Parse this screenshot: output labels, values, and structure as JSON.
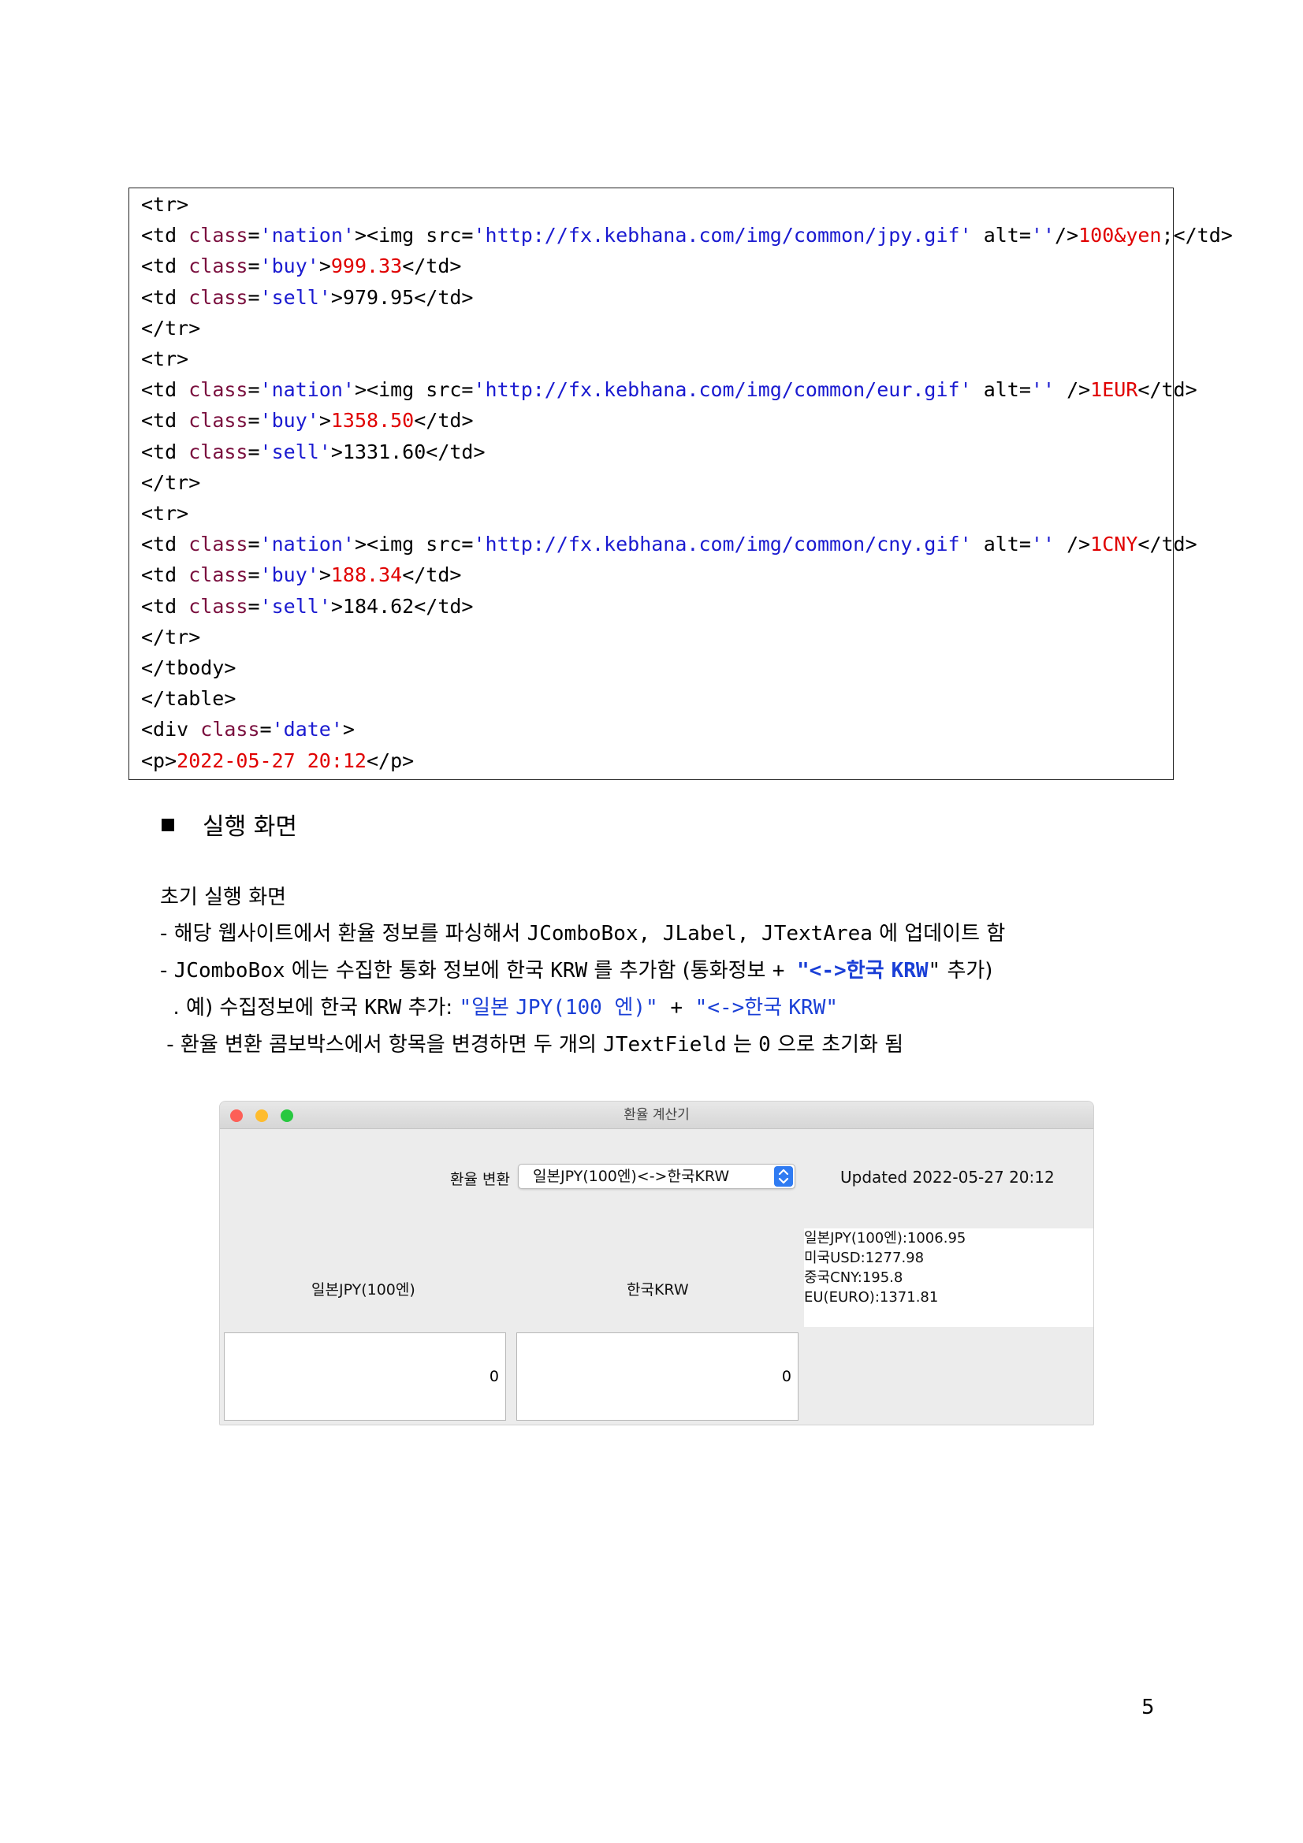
{
  "code": {
    "lines": [
      [
        {
          "t": "t",
          "x": "<tr>"
        }
      ],
      [
        {
          "t": "t",
          "x": "<td "
        },
        {
          "t": "k",
          "x": "class"
        },
        {
          "t": "t",
          "x": "="
        },
        {
          "t": "s",
          "x": "'nation'"
        },
        {
          "t": "t",
          "x": "><img src="
        },
        {
          "t": "s",
          "x": "'http://fx.kebhana.com/img/common/jpy.gif'"
        },
        {
          "t": "t",
          "x": " alt="
        },
        {
          "t": "s",
          "x": "''"
        },
        {
          "t": "t",
          "x": "/>"
        },
        {
          "t": "v",
          "x": "100&yen"
        },
        {
          "t": "t",
          "x": ";</td>"
        }
      ],
      [
        {
          "t": "t",
          "x": "<td "
        },
        {
          "t": "k",
          "x": "class"
        },
        {
          "t": "t",
          "x": "="
        },
        {
          "t": "s",
          "x": "'buy'"
        },
        {
          "t": "t",
          "x": ">"
        },
        {
          "t": "v",
          "x": "999.33"
        },
        {
          "t": "t",
          "x": "</td>"
        }
      ],
      [
        {
          "t": "t",
          "x": "<td "
        },
        {
          "t": "k",
          "x": "class"
        },
        {
          "t": "t",
          "x": "="
        },
        {
          "t": "s",
          "x": "'sell'"
        },
        {
          "t": "t",
          "x": ">979.95</td>"
        }
      ],
      [
        {
          "t": "t",
          "x": "</tr>"
        }
      ],
      [
        {
          "t": "t",
          "x": "<tr>"
        }
      ],
      [
        {
          "t": "t",
          "x": "<td "
        },
        {
          "t": "k",
          "x": "class"
        },
        {
          "t": "t",
          "x": "="
        },
        {
          "t": "s",
          "x": "'nation'"
        },
        {
          "t": "t",
          "x": "><img src="
        },
        {
          "t": "s",
          "x": "'http://fx.kebhana.com/img/common/eur.gif'"
        },
        {
          "t": "t",
          "x": " alt="
        },
        {
          "t": "s",
          "x": "''"
        },
        {
          "t": "t",
          "x": " />"
        },
        {
          "t": "v",
          "x": "1EUR"
        },
        {
          "t": "t",
          "x": "</td>"
        }
      ],
      [
        {
          "t": "t",
          "x": "<td "
        },
        {
          "t": "k",
          "x": "class"
        },
        {
          "t": "t",
          "x": "="
        },
        {
          "t": "s",
          "x": "'buy'"
        },
        {
          "t": "t",
          "x": ">"
        },
        {
          "t": "v",
          "x": "1358.50"
        },
        {
          "t": "t",
          "x": "</td>"
        }
      ],
      [
        {
          "t": "t",
          "x": "<td "
        },
        {
          "t": "k",
          "x": "class"
        },
        {
          "t": "t",
          "x": "="
        },
        {
          "t": "s",
          "x": "'sell'"
        },
        {
          "t": "t",
          "x": ">1331.60</td>"
        }
      ],
      [
        {
          "t": "t",
          "x": "</tr>"
        }
      ],
      [
        {
          "t": "t",
          "x": "<tr>"
        }
      ],
      [
        {
          "t": "t",
          "x": "<td "
        },
        {
          "t": "k",
          "x": "class"
        },
        {
          "t": "t",
          "x": "="
        },
        {
          "t": "s",
          "x": "'nation'"
        },
        {
          "t": "t",
          "x": "><img src="
        },
        {
          "t": "s",
          "x": "'http://fx.kebhana.com/img/common/cny.gif'"
        },
        {
          "t": "t",
          "x": " alt="
        },
        {
          "t": "s",
          "x": "''"
        },
        {
          "t": "t",
          "x": " />"
        },
        {
          "t": "v",
          "x": "1CNY"
        },
        {
          "t": "t",
          "x": "</td>"
        }
      ],
      [
        {
          "t": "t",
          "x": "<td "
        },
        {
          "t": "k",
          "x": "class"
        },
        {
          "t": "t",
          "x": "="
        },
        {
          "t": "s",
          "x": "'buy'"
        },
        {
          "t": "t",
          "x": ">"
        },
        {
          "t": "v",
          "x": "188.34"
        },
        {
          "t": "t",
          "x": "</td>"
        }
      ],
      [
        {
          "t": "t",
          "x": "<td "
        },
        {
          "t": "k",
          "x": "class"
        },
        {
          "t": "t",
          "x": "="
        },
        {
          "t": "s",
          "x": "'sell'"
        },
        {
          "t": "t",
          "x": ">184.62</td>"
        }
      ],
      [
        {
          "t": "t",
          "x": "</tr>"
        }
      ],
      [
        {
          "t": "t",
          "x": "</tbody>"
        }
      ],
      [
        {
          "t": "t",
          "x": "</table>"
        }
      ],
      [
        {
          "t": "t",
          "x": "<div "
        },
        {
          "t": "k",
          "x": "class"
        },
        {
          "t": "t",
          "x": "="
        },
        {
          "t": "s",
          "x": "'date'"
        },
        {
          "t": "t",
          "x": ">"
        }
      ],
      [
        {
          "t": "t",
          "x": "<p>"
        },
        {
          "t": "v",
          "x": "2022-05-27 20:12"
        },
        {
          "t": "t",
          "x": "</p>"
        }
      ]
    ]
  },
  "section": {
    "title": "실행 화면"
  },
  "desc": {
    "heading": "초기 실행 화면",
    "l1": [
      {
        "t": "n",
        "x": "- 해당 웹사이트에서 환율 정보를 파싱해서 "
      },
      {
        "t": "m",
        "x": "JComboBox, JLabel, JTextArea"
      },
      {
        "t": "n",
        "x": " 에 업데이트 함"
      }
    ],
    "l2": [
      {
        "t": "n",
        "x": "- "
      },
      {
        "t": "m",
        "x": "JComboBox"
      },
      {
        "t": "n",
        "x": " 에는 수집한 통화 정보에 한국 "
      },
      {
        "t": "m",
        "x": "KRW"
      },
      {
        "t": "n",
        "x": " 를 추가함 (통화정보 "
      },
      {
        "t": "m",
        "x": "+ "
      },
      {
        "t": "mb",
        "x": "\"<->"
      },
      {
        "t": "bb",
        "x": "한국 "
      },
      {
        "t": "mb",
        "x": "KRW"
      },
      {
        "t": "m",
        "x": "\""
      },
      {
        "t": "n",
        "x": " 추가)"
      }
    ],
    "l3": [
      {
        "t": "n",
        "x": "  . 예) 수집정보에 한국 "
      },
      {
        "t": "m",
        "x": "KRW"
      },
      {
        "t": "n",
        "x": " 추가: "
      },
      {
        "t": "bm",
        "x": "\""
      },
      {
        "t": "b",
        "x": "일본 "
      },
      {
        "t": "bm",
        "x": "JPY(100 "
      },
      {
        "t": "b",
        "x": "엔"
      },
      {
        "t": "bm",
        "x": ")\""
      },
      {
        "t": "m",
        "x": " + "
      },
      {
        "t": "bm",
        "x": "\"<->"
      },
      {
        "t": "b",
        "x": "한국 "
      },
      {
        "t": "bm",
        "x": "KRW\""
      }
    ],
    "l4": [
      {
        "t": "n",
        "x": " - 환율 변환 콤보박스에서 항목을 변경하면 두 개의 "
      },
      {
        "t": "m",
        "x": "JTextField"
      },
      {
        "t": "n",
        "x": " 는 "
      },
      {
        "t": "m",
        "x": "0"
      },
      {
        "t": "n",
        "x": " 으로 초기화 됨"
      }
    ]
  },
  "app": {
    "title": "환율 계산기",
    "combo_label": "환율 변환",
    "combo_value": "일본JPY(100엔)<->한국KRW",
    "updated": "Updated 2022-05-27 20:12",
    "rates": [
      "일본JPY(100엔):1006.95",
      "미국USD:1277.98",
      "중국CNY:195.8",
      "EU(EURO):1371.81"
    ],
    "left_label": "일본JPY(100엔)",
    "right_label": "한국KRW",
    "left_value": "0",
    "right_value": "0",
    "colors": {
      "close": "#fd5f57",
      "minimize": "#febc2e",
      "zoom": "#28c840",
      "combo_arrow": "#2f7bf2"
    }
  },
  "page_number": "5"
}
